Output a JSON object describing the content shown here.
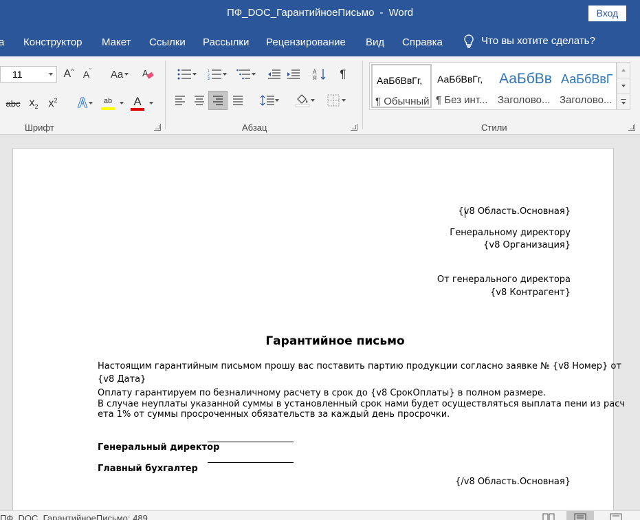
{
  "window": {
    "doc_name": "ПФ_DOC_ГарантийноеПисьмо",
    "separator": "-",
    "app_name": "Word",
    "login_label": "Вход"
  },
  "tabs": [
    "а",
    "Конструктор",
    "Макет",
    "Ссылки",
    "Рассылки",
    "Рецензирование",
    "Вид",
    "Справка"
  ],
  "tellme": {
    "label": "Что вы хотите сделать?",
    "icon": "lightbulb-icon"
  },
  "ribbon": {
    "font_group": {
      "label": "Шрифт",
      "font_size": "11",
      "grow_font": "A",
      "shrink_font": "A",
      "change_case": "Aa",
      "strikethrough": "abc",
      "subscript_base": "x",
      "subscript_mark": "2",
      "superscript_base": "x",
      "superscript_mark": "2",
      "text_effects": "A",
      "highlight": "ab",
      "font_color": "A",
      "highlight_color": "#ffff00",
      "font_color_value": "#e00000"
    },
    "paragraph_group": {
      "label": "Абзац",
      "pilcrow": "¶"
    },
    "styles_group": {
      "label": "Стили",
      "items": [
        {
          "sample": "АаБбВвГг,",
          "name": "¶ Обычный"
        },
        {
          "sample": "АаБбВвГг,",
          "name": "¶ Без инт..."
        },
        {
          "sample": "АаБбВв",
          "name": "Заголово..."
        },
        {
          "sample": "АаБбВвГ",
          "name": "Заголово..."
        }
      ]
    }
  },
  "document": {
    "region_open": "{v8 Область.Основная}",
    "to_line1": "Генеральному директору",
    "to_line2": "{v8 Организация}",
    "from_line1": "От генерального директора",
    "from_line2": "{v8 Контрагент}",
    "title": "Гарантийное письмо",
    "body_line1": "Настоящим гарантийным письмом прошу вас поставить партию продукции согласно заявке № {v8 Номер} от",
    "body_line2": "{v8 Дата}",
    "body_line3": "Оплату гарантируем по безналичному расчету в срок до {v8 СрокОплаты} в полном размере.",
    "body_line4": "В случае неуплаты указанной суммы в установленный срок нами будет осуществляться выплата пени из расч",
    "body_line5": "ета 1% от суммы просроченных обязательств за каждый день просрочки.",
    "sign1": "Генеральный директор",
    "sign2": "Главный бухгалтер",
    "region_close": "{/v8 Область.Основная}"
  },
  "status": {
    "text": "ПФ_DOC_ГарантийноеПисьмо: 489"
  },
  "colors": {
    "accent": "#2b579a",
    "ribbon_bg": "#f3f3f3",
    "heading_style": "#2e74b5"
  }
}
